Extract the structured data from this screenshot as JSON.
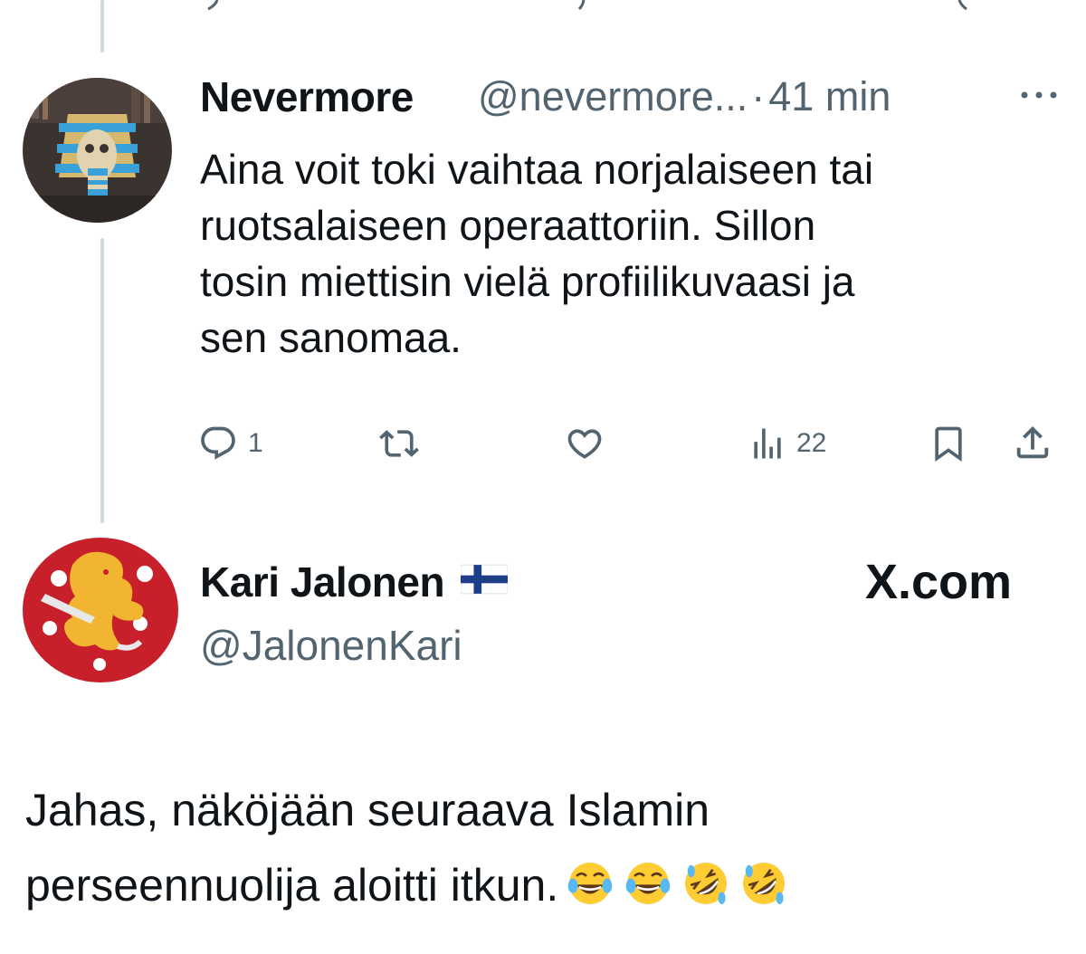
{
  "reply": {
    "name": "Nevermore",
    "handle": "@nevermore...",
    "separator": "·",
    "time": "41 min",
    "lines": [
      "Aina voit toki vaihtaa norjalaiseen tai",
      "ruotsalaiseen operaattoriin. Sillon",
      "tosin miettisin vielä profiilikuvaasi ja",
      "sen sanomaa."
    ],
    "actions": {
      "reply_count": "1",
      "repost_count": "",
      "like_count": "",
      "views_count": "22"
    }
  },
  "quoted": {
    "name": "Kari Jalonen",
    "flag_icon": "finland-flag-icon",
    "handle": "@JalonenKari",
    "watermark": "X.com",
    "lines": [
      "Jahas, näköjään seuraava Islamin",
      "perseennuolija aloitti itkun."
    ],
    "emojis": [
      "laughing-tears-emoji",
      "laughing-tears-emoji",
      "rofl-emoji",
      "rofl-emoji"
    ]
  },
  "colors": {
    "muted": "#536471",
    "thread_line": "#cfd9de",
    "text": "#0f1419",
    "emoji_yellow": "#ffcc33"
  }
}
